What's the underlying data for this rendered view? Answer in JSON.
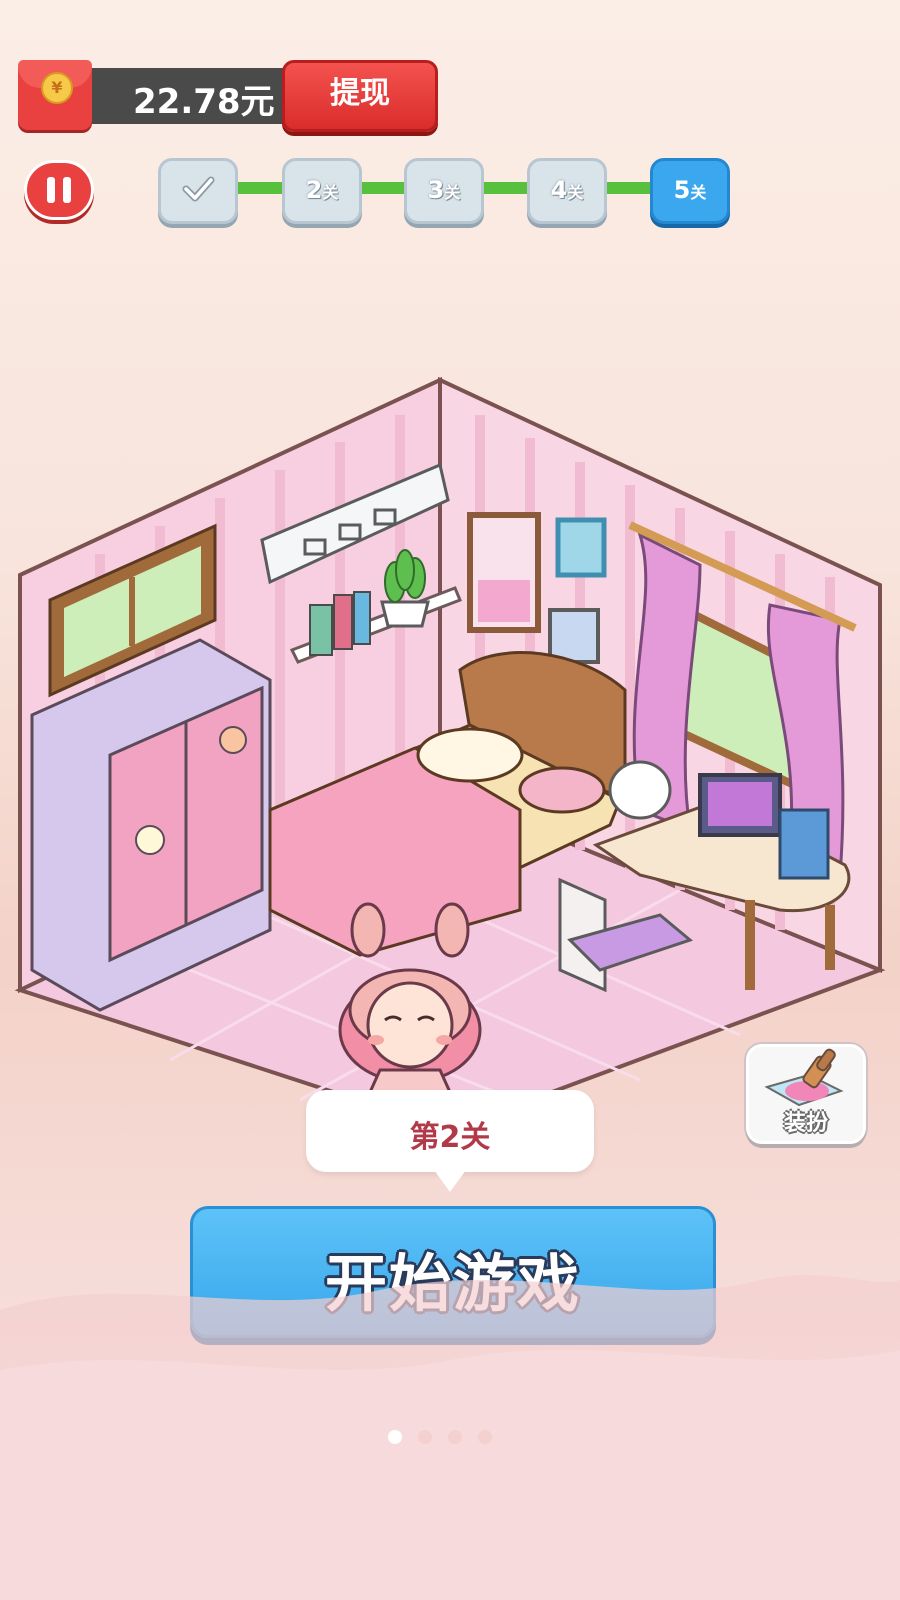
{
  "wallet": {
    "amount": "22.78元",
    "coin_symbol": "¥",
    "withdraw_label": "提现"
  },
  "progress": {
    "levels": [
      {
        "label": "",
        "unit": "",
        "state": "completed",
        "icon": "check-icon"
      },
      {
        "label": "2",
        "unit": "关",
        "state": "locked"
      },
      {
        "label": "3",
        "unit": "关",
        "state": "locked"
      },
      {
        "label": "4",
        "unit": "关",
        "state": "locked"
      },
      {
        "label": "5",
        "unit": "关",
        "state": "current"
      }
    ]
  },
  "dress_up": {
    "label": "装扮",
    "icon": "paint-brush-icon"
  },
  "level_bubble": {
    "text": "第2关"
  },
  "start_button": {
    "label": "开始游戏"
  },
  "page_indicator": {
    "count": 4,
    "active": 1
  },
  "colors": {
    "accent_red": "#e8413f",
    "accent_blue": "#3aa7ee",
    "progress_green": "#57c13e"
  }
}
